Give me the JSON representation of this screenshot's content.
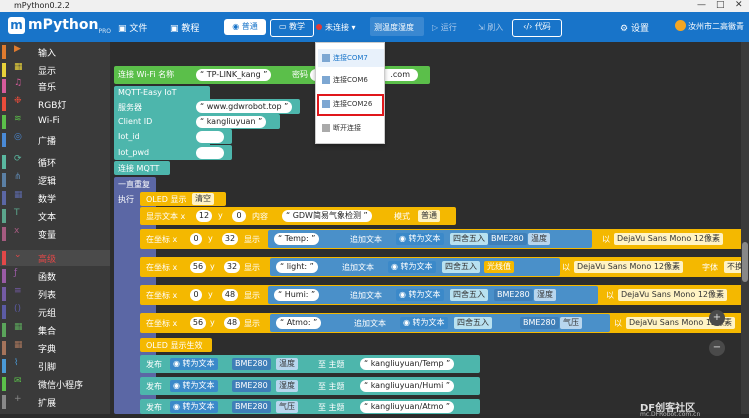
{
  "window": {
    "title": "mPython0.2.2",
    "controls": [
      "—",
      "□",
      "✕"
    ]
  },
  "toolbar": {
    "logo": "mPython",
    "logo_sub": "PRO",
    "file": "文件",
    "tutorial": "教程",
    "mode_normal": "普通",
    "mode_teach": "教学",
    "connection": "未连接",
    "project_name": "测温度湿度",
    "run": "运行",
    "flash": "刷入",
    "code": "代码",
    "settings": "设置",
    "school": "汝州市二高徽青"
  },
  "sidebar": {
    "items": [
      {
        "label": "输入",
        "color": "#e07b2e",
        "icon": "input-icon"
      },
      {
        "label": "显示",
        "color": "#e8d23a",
        "icon": "display-icon"
      },
      {
        "label": "音乐",
        "color": "#d65b9b",
        "icon": "music-icon"
      },
      {
        "label": "RGB灯",
        "color": "#e94c3a",
        "icon": "rgb-icon"
      },
      {
        "label": "Wi-Fi",
        "color": "#5bbf4a",
        "icon": "wifi-icon"
      },
      {
        "label": "广播",
        "color": "#4a8ad6",
        "icon": "broadcast-icon"
      },
      {
        "label": "循环",
        "color": "#5ab8a0",
        "icon": "loop-icon"
      },
      {
        "label": "逻辑",
        "color": "#5b80a5",
        "icon": "logic-icon"
      },
      {
        "label": "数学",
        "color": "#5b67a5",
        "icon": "math-icon"
      },
      {
        "label": "文本",
        "color": "#5ba58c",
        "icon": "text-icon"
      },
      {
        "label": "变量",
        "color": "#a55b80",
        "icon": "variable-icon"
      },
      {
        "label": "高级",
        "color": "#e24848",
        "icon": "advanced-icon"
      },
      {
        "label": "函数",
        "color": "#9a5ba5",
        "icon": "function-icon"
      },
      {
        "label": "列表",
        "color": "#745ba5",
        "icon": "list-icon"
      },
      {
        "label": "元组",
        "color": "#5b5ba5",
        "icon": "tuple-icon"
      },
      {
        "label": "集合",
        "color": "#5ba55b",
        "icon": "set-icon"
      },
      {
        "label": "字典",
        "color": "#a5745b",
        "icon": "dict-icon"
      },
      {
        "label": "引脚",
        "color": "#4a9ad6",
        "icon": "pin-icon"
      },
      {
        "label": "微信小程序",
        "color": "#5bbf4a",
        "icon": "wechat-icon"
      },
      {
        "label": "扩展",
        "color": "#888888",
        "icon": "extend-icon"
      }
    ]
  },
  "menu": {
    "items": [
      "连接COM7",
      "连接COM6",
      "连接COM26",
      "断开连接"
    ]
  },
  "blocks": {
    "wifi_label": "连接 Wi-Fi 名称",
    "wifi_name": "TP-LINK_kang",
    "wifi_pwd_label": "密码",
    "wifi_pwd_tail": ".com",
    "mqtt_title": "MQTT-Easy IoT",
    "server_label": "服务器",
    "server": "www.gdwrobot.top",
    "client_label": "Client ID",
    "client": "kangliuyuan",
    "iotid_label": "Iot_id",
    "iotpwd_label": "Iot_pwd",
    "connect_mqtt": "连接 MQTT",
    "forever": "一直重复",
    "exec": "执行",
    "oled_show": "OLED 显示",
    "clear": "清空",
    "show_text": "显示文本 x",
    "y": "y",
    "content": "内容",
    "mode": "模式",
    "normal": "普通",
    "title_text": "GDW简易气象检测",
    "at_xy": "在坐标 x",
    "show": "显示",
    "append": "追加文本",
    "to_text": "转为文本",
    "round": "四舍五入",
    "by": "以",
    "font": "DejaVu Sans Mono 12像素",
    "font_label": "字体",
    "nowrap": "不换",
    "sensor": "BME280",
    "temp": "温度",
    "light": "光线值",
    "humi": "湿度",
    "press": "气压",
    "temp_lbl": "Temp:",
    "light_lbl": "light:",
    "humi_lbl": "Humi:",
    "atmo_lbl": "Atmo:",
    "oled_apply": "OLED 显示生效",
    "publish": "发布",
    "to_topic": "至 主题",
    "topic_temp": "kangliuyuan/Temp",
    "topic_humi": "kangliuyuan/Humi",
    "topic_atmo": "kangliuyuan/Atmo",
    "nums": {
      "x12": "12",
      "y0": "0",
      "x0": "0",
      "y32": "32",
      "x56": "56",
      "y48": "48"
    }
  },
  "watermark": {
    "brand": "DF创客社区",
    "url": "mc.DFRobot.com.cn"
  },
  "zoom": {
    "plus": "+",
    "minus": "−"
  }
}
